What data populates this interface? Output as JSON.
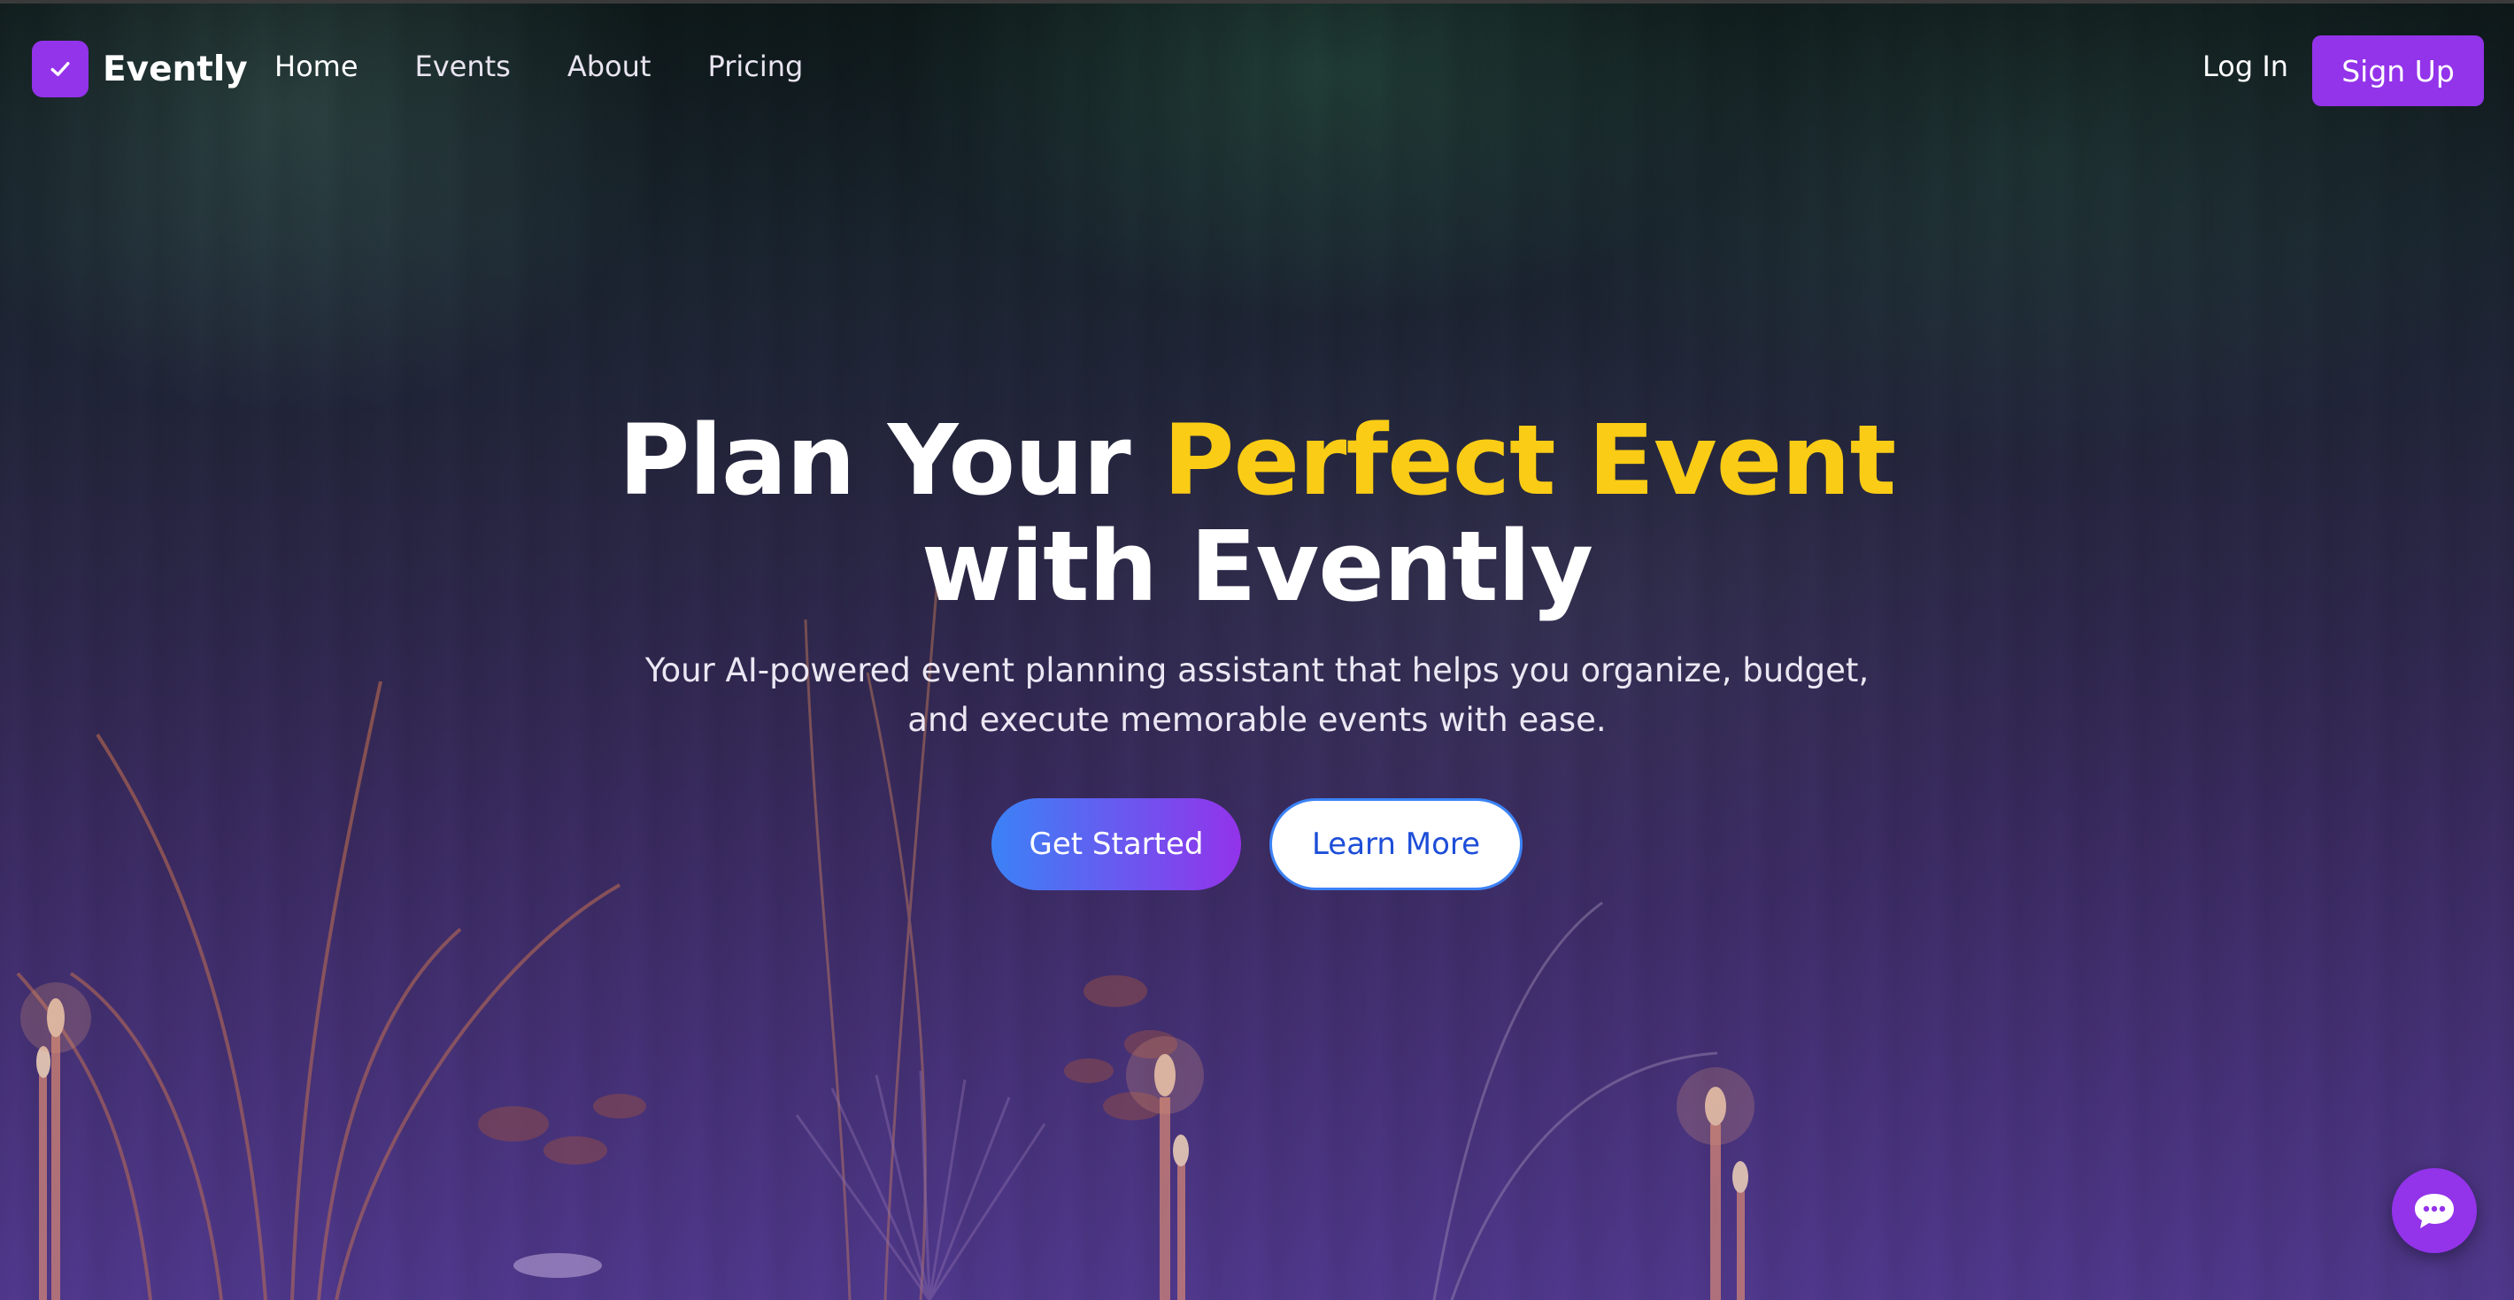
{
  "brand": {
    "name": "Evently",
    "logo_icon": "check-icon",
    "color": "#9333ea"
  },
  "nav": {
    "items": [
      {
        "label": "Home"
      },
      {
        "label": "Events"
      },
      {
        "label": "About"
      },
      {
        "label": "Pricing"
      }
    ]
  },
  "auth": {
    "login_label": "Log In",
    "signup_label": "Sign Up"
  },
  "hero": {
    "title_part1": "Plan Your ",
    "title_highlight": "Perfect Event",
    "title_part2": "with Evently",
    "subtitle": "Your AI-powered event planning assistant that helps you organize, budget, and execute memorable events with ease.",
    "primary_cta": "Get Started",
    "secondary_cta": "Learn More",
    "highlight_color": "#facc15"
  },
  "chat": {
    "icon": "chat-bubble-icon"
  },
  "colors": {
    "accent": "#9333ea",
    "gradient_start": "#3b82f6",
    "gradient_end": "#9333ea"
  }
}
